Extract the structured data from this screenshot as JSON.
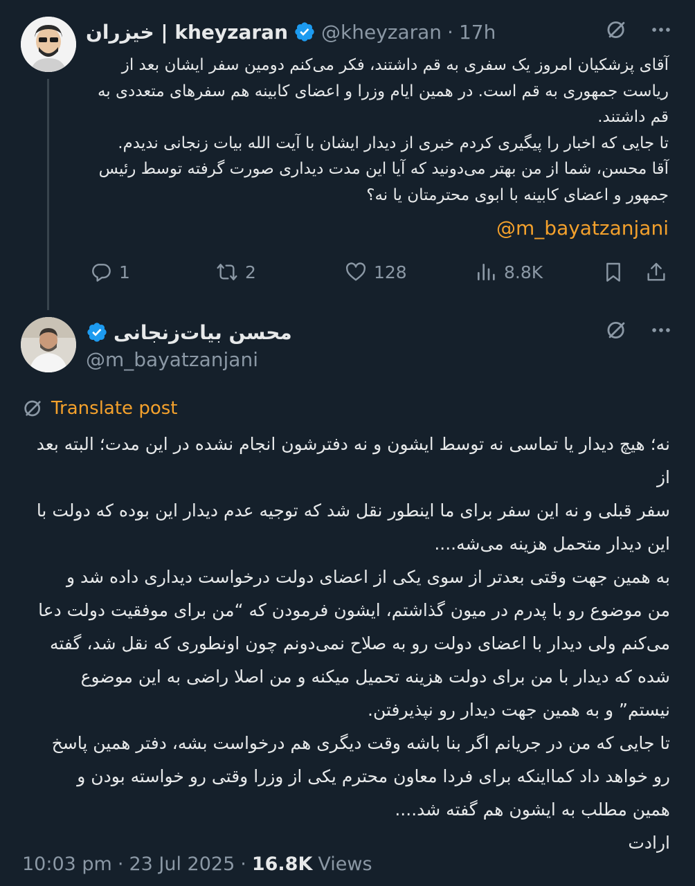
{
  "parent_tweet": {
    "display_name": "خیزران | kheyzaran",
    "handle": "@kheyzaran",
    "separator": "·",
    "time": "17h",
    "body": "آقای پزشکیان امروز یک سفری به قم داشتند، فکر می‌کنم دومین سفر ایشان بعد از\nریاست جمهوری به قم است. در همین ایام وزرا و اعضای کابینه هم سفرهای متعددی به\nقم داشتند.\nتا جایی که اخبار را پیگیری کردم خبری از دیدار ایشان با آیت الله بیات زنجانی ندیدم.\nآقا محسن، شما از من بهتر می‌دونید که آیا این مدت دیداری صورت گرفته توسط رئیس\nجمهور و اعضای کابینه با ابوی محترمتان یا نه؟",
    "mention": "@m_bayatzanjani",
    "stats": {
      "replies": "1",
      "reposts": "2",
      "likes": "128",
      "views": "8.8K"
    }
  },
  "reply_tweet": {
    "display_name": "محسن بیات‌زنجانی",
    "handle": "@m_bayatzanjani",
    "translate_label": "Translate post",
    "body": "نه؛ هیچ دیدار یا تماسی نه توسط ایشون و نه دفترشون انجام نشده در این مدت؛ البته بعد از\nسفر قبلی و نه این سفر برای ما اینطور نقل شد که توجیه عدم دیدار این بوده که دولت با\nاین دیدار متحمل هزینه می‌شه....\nبه همین جهت وقتی بعدتر از سوی یکی از اعضای دولت درخواست دیداری داده شد و\nمن موضوع رو با پدرم در میون گذاشتم، ایشون فرمودن که “من برای موفقیت دولت دعا\nمی‌کنم ولی دیدار با اعضای دولت رو به صلاح نمی‌دونم چون اونطوری که نقل شد، گفته\nشده که دیدار با من برای دولت هزینه تحمیل میکنه و من اصلا راضی به این موضوع\nنیستم” و به همین جهت دیدار رو نپذیرفتن.\nتا جایی که من در جریانم اگر بنا باشه وقت دیگری هم درخواست بشه، دفتر همین پاسخ\nرو خواهد داد کمااینکه برای فردا معاون محترم یکی از وزرا وقتی رو خواسته بودن و\nهمین مطلب به ایشون هم گفته شد....\nارادت",
    "time": "10:03 pm",
    "separator": "·",
    "date": "23 Jul 2025",
    "views_count": "16.8K",
    "views_label": "Views"
  },
  "icons": {
    "verified": "verified-badge-icon",
    "grok": "grok-icon",
    "more": "more-icon",
    "reply": "reply-icon",
    "retweet": "retweet-icon",
    "like": "heart-icon",
    "views": "views-icon",
    "bookmark": "bookmark-icon",
    "share": "share-icon",
    "translate": "globe-icon"
  },
  "colors": {
    "background": "#15202b",
    "text": "#e7e9ea",
    "muted": "#8b98a5",
    "accent": "#f4a12c",
    "verified": "#1d9bf0"
  }
}
